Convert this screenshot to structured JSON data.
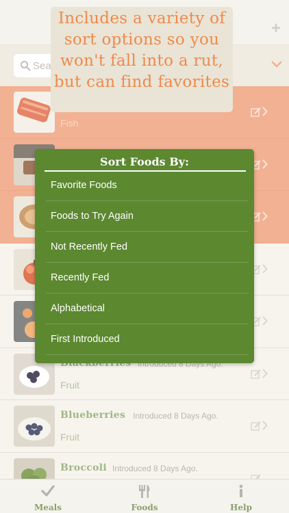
{
  "search": {
    "placeholder": "Sea"
  },
  "callout": {
    "text": "Includes a variety of sort options so you won't fall into a rut, but can find favorites"
  },
  "sort_menu": {
    "title": "Sort Foods By:",
    "options": [
      "Favorite Foods",
      "Foods to Try Again",
      "Not Recently Fed",
      "Recently Fed",
      "Alphabetical",
      "First Introduced"
    ]
  },
  "foods": [
    {
      "category": "Fish",
      "favorite": true
    },
    {
      "favorite": true
    },
    {
      "favorite": true
    },
    {
      "favorite": false
    },
    {
      "favorite": false
    },
    {
      "name": "Blackberries",
      "introduced": "Introduced 8 Days Ago.",
      "category": "Fruit",
      "favorite": false
    },
    {
      "name": "Blueberries",
      "introduced": "Introduced 8 Days Ago.",
      "category": "Fruit",
      "favorite": false
    },
    {
      "name": "Broccoli",
      "introduced": "Introduced 8 Days Ago.",
      "favorite": false
    }
  ],
  "tabs": [
    {
      "label": "Meals",
      "icon": "checkmark-icon"
    },
    {
      "label": "Foods",
      "icon": "fork-knife-icon"
    },
    {
      "label": "Help",
      "icon": "info-icon"
    }
  ],
  "colors": {
    "accent_orange": "#ee8a4c",
    "favorite_row": "#f0a07a",
    "menu_green": "#5c8830",
    "tab_green": "#6f8b4c"
  }
}
